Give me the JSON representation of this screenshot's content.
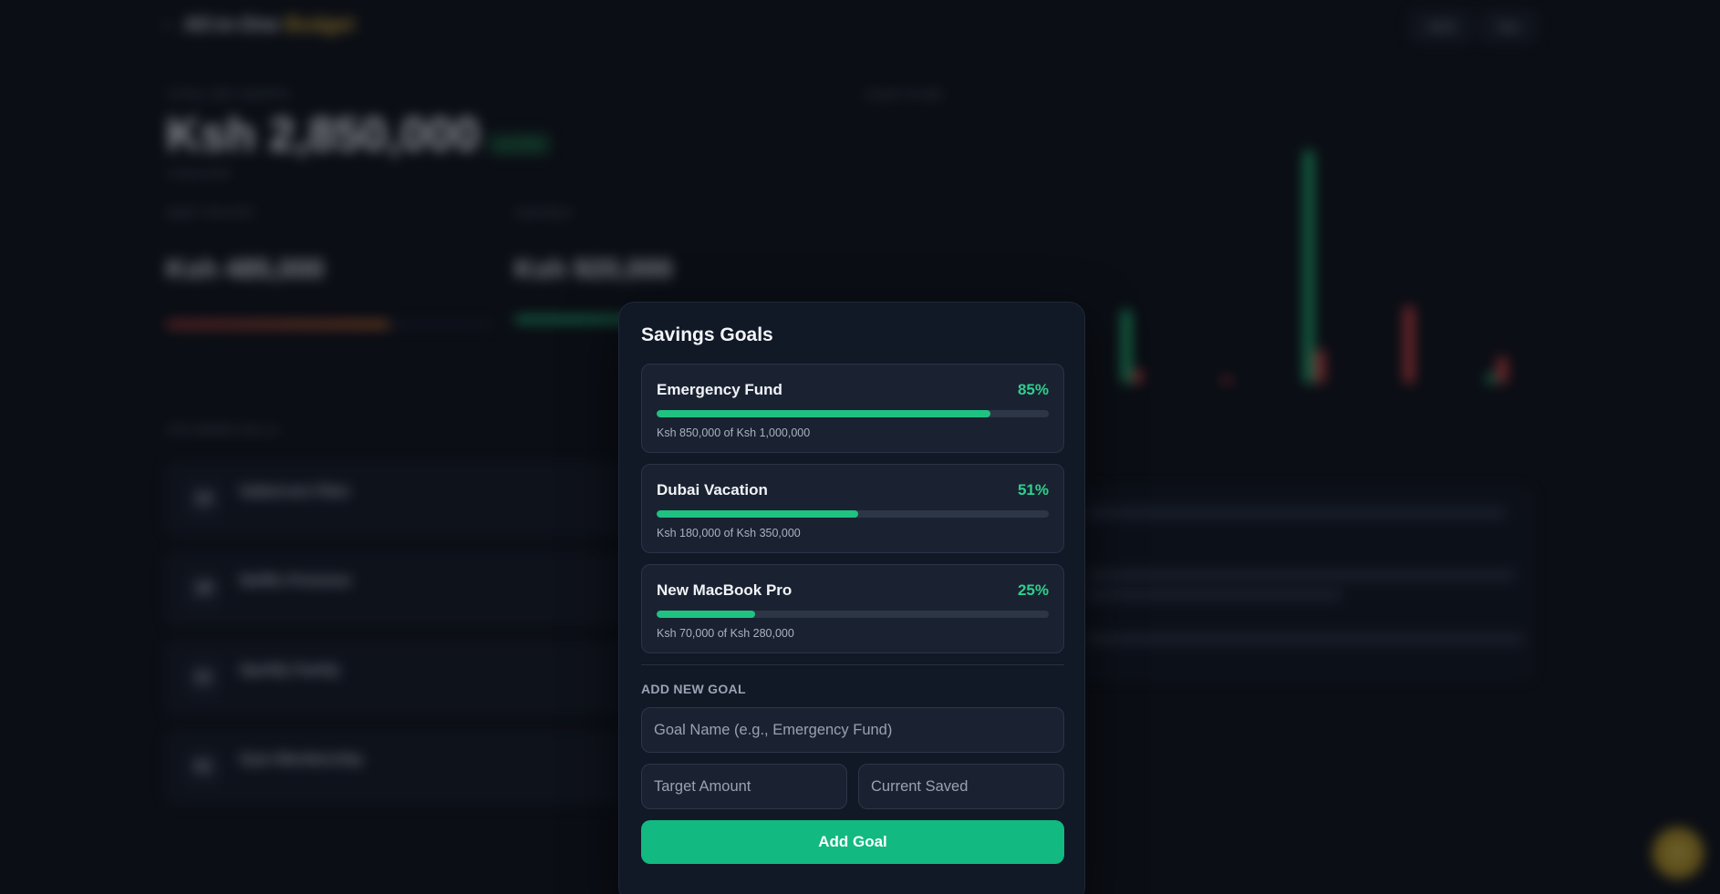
{
  "background": {
    "header": {
      "title_main": "All-in-One",
      "title_accent": "Budget",
      "year": "2025",
      "month": "Dec"
    },
    "net_worth": {
      "label": "TOTAL NET WORTH",
      "value": "Ksh 2,850,000",
      "badge": "▲ 8.4%",
      "sub": "vs last month"
    },
    "debt": {
      "label": "DEBT PAYOFF",
      "value": "Ksh 485,000"
    },
    "savings": {
      "label": "SAVINGS",
      "value": "Ksh 920,000"
    },
    "bills": {
      "label": "UPCOMING BILLS",
      "items": [
        {
          "day": "15",
          "name": "Safaricom Fiber"
        },
        {
          "day": "18",
          "name": "Netflix Premium"
        },
        {
          "day": "21",
          "name": "Spotify Family"
        },
        {
          "day": "01",
          "name": "Gym Membership"
        }
      ]
    },
    "cash_flow": {
      "label": "CASH FLOW"
    },
    "fab_symbol": "+",
    "accent_color": "#e0b23a"
  },
  "modal": {
    "title": "Savings Goals",
    "goals": [
      {
        "name": "Emergency Fund",
        "percent": "85%",
        "progress": 0.85,
        "detail": "Ksh 850,000 of Ksh 1,000,000"
      },
      {
        "name": "Dubai Vacation",
        "percent": "51%",
        "progress": 0.514,
        "detail": "Ksh 180,000 of Ksh 350,000"
      },
      {
        "name": "New MacBook Pro",
        "percent": "25%",
        "progress": 0.25,
        "detail": "Ksh 70,000 of Ksh 280,000"
      }
    ],
    "add_section_label": "ADD NEW GOAL",
    "goal_name_placeholder": "Goal Name (e.g., Emergency Fund)",
    "target_placeholder": "Target Amount",
    "current_placeholder": "Current Saved",
    "add_button_label": "Add Goal",
    "progress_color": "#1fc281",
    "button_color": "#12b981"
  }
}
